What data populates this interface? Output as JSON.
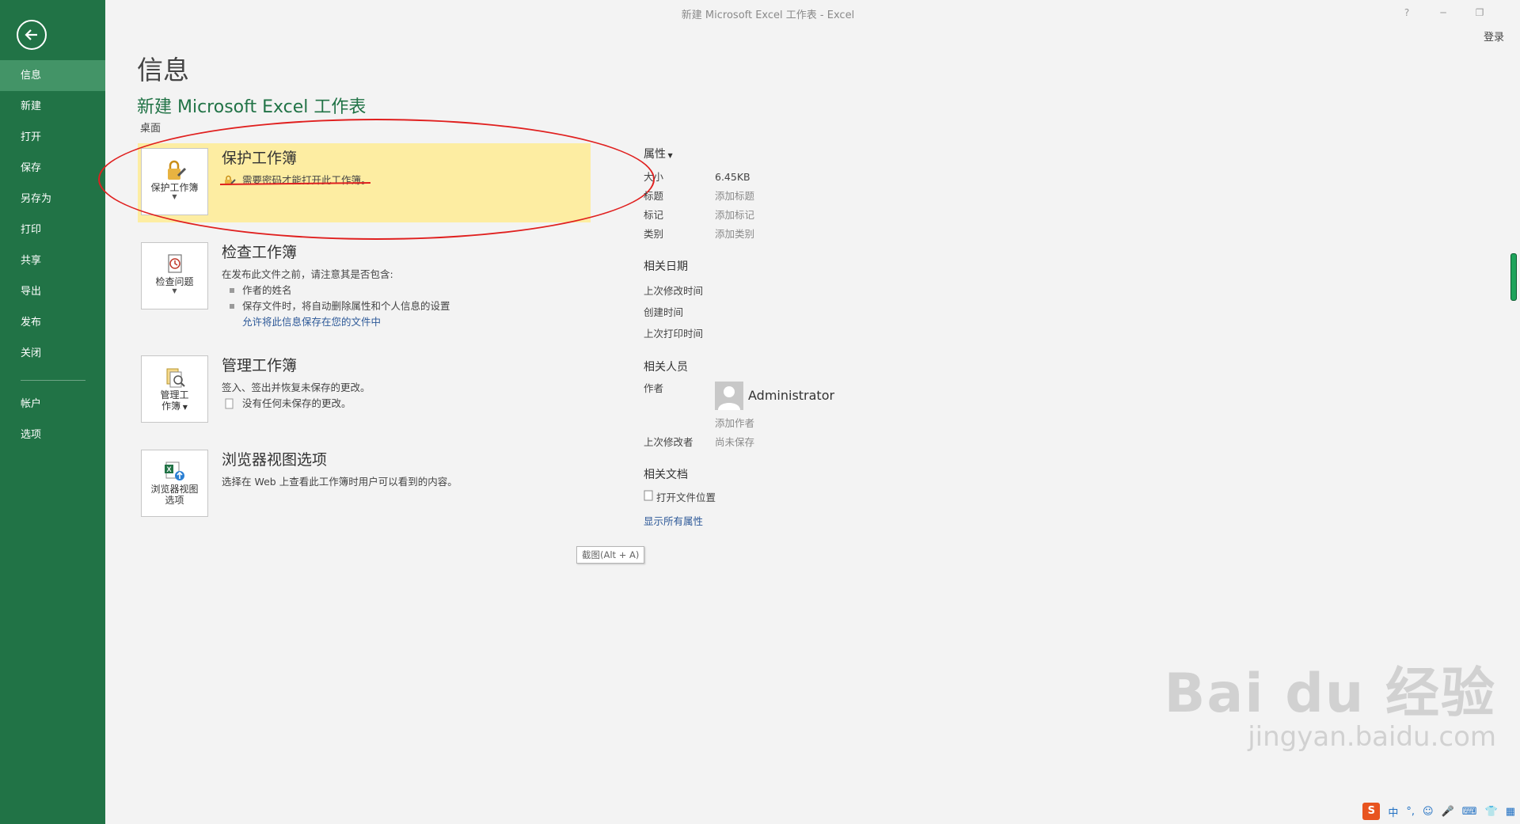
{
  "window": {
    "title": "新建 Microsoft Excel 工作表 - Excel",
    "help": "?",
    "minimize": "─",
    "restore": "❐",
    "signin": "登录"
  },
  "sidebar": {
    "items": [
      {
        "label": "信息",
        "active": true
      },
      {
        "label": "新建"
      },
      {
        "label": "打开"
      },
      {
        "label": "保存"
      },
      {
        "label": "另存为"
      },
      {
        "label": "打印"
      },
      {
        "label": "共享"
      },
      {
        "label": "导出"
      },
      {
        "label": "发布"
      },
      {
        "label": "关闭"
      }
    ],
    "bottom_items": [
      {
        "label": "帐户"
      },
      {
        "label": "选项"
      }
    ]
  },
  "main": {
    "page_title": "信息",
    "doc_name": "新建 Microsoft Excel 工作表",
    "doc_location": "桌面",
    "sections": {
      "protect": {
        "tile_label": "保护工作簿",
        "title": "保护工作簿",
        "desc": "需要密码才能打开此工作簿。"
      },
      "inspect": {
        "tile_label": "检查问题",
        "title": "检查工作簿",
        "desc": "在发布此文件之前，请注意其是否包含:",
        "bullets": [
          "作者的姓名",
          "保存文件时，将自动删除属性和个人信息的设置"
        ],
        "link": "允许将此信息保存在您的文件中"
      },
      "manage": {
        "tile_label_1": "管理工",
        "tile_label_2": "作簿",
        "title": "管理工作簿",
        "desc": "签入、签出并恢复未保存的更改。",
        "note": "没有任何未保存的更改。"
      },
      "browser": {
        "tile_label_1": "浏览器视图",
        "tile_label_2": "选项",
        "title": "浏览器视图选项",
        "desc": "选择在 Web 上查看此工作簿时用户可以看到的内容。"
      }
    }
  },
  "properties": {
    "heading": "属性",
    "rows": [
      {
        "key": "大小",
        "value": "6.45KB"
      },
      {
        "key": "标题",
        "value": "添加标题"
      },
      {
        "key": "标记",
        "value": "添加标记"
      },
      {
        "key": "类别",
        "value": "添加类别"
      }
    ],
    "dates_heading": "相关日期",
    "dates": [
      "上次修改时间",
      "创建时间",
      "上次打印时间"
    ],
    "people_heading": "相关人员",
    "author_key": "作者",
    "author_name": "Administrator",
    "add_author": "添加作者",
    "last_modified_by_key": "上次修改者",
    "last_modified_by_value": "尚未保存",
    "docs_heading": "相关文档",
    "open_location": "打开文件位置",
    "show_all": "显示所有属性"
  },
  "tooltip": "截图(Alt + A)",
  "watermark": {
    "main": "Bai du 经验",
    "sub": "jingyan.baidu.com"
  },
  "ime": {
    "logo": "S",
    "mode": "中",
    "punct": "°,"
  }
}
